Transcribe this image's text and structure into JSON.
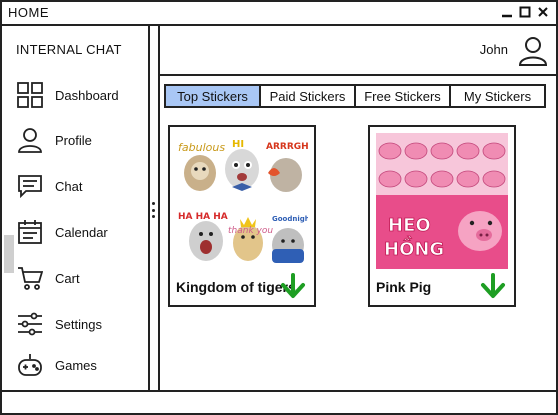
{
  "window": {
    "title": "HOME",
    "controls": [
      "minimize-icon",
      "maximize-icon",
      "close-icon"
    ]
  },
  "sidebar": {
    "app_title": "INTERNAL CHAT",
    "items": [
      {
        "label": "Dashboard",
        "icon": "dashboard-grid-icon"
      },
      {
        "label": "Profile",
        "icon": "user-icon"
      },
      {
        "label": "Chat",
        "icon": "chat-icon"
      },
      {
        "label": "Calendar",
        "icon": "calendar-icon"
      },
      {
        "label": "Cart",
        "icon": "cart-icon"
      },
      {
        "label": "Settings",
        "icon": "sliders-icon"
      },
      {
        "label": "Games",
        "icon": "gamepad-icon"
      }
    ],
    "active_index": 4
  },
  "header": {
    "user_name": "John",
    "avatar_icon": "user-icon"
  },
  "tabs": [
    {
      "label": "Top Stickers",
      "active": true
    },
    {
      "label": "Paid Stickers",
      "active": false
    },
    {
      "label": "Free Stickers",
      "active": false
    },
    {
      "label": "My Stickers",
      "active": false
    }
  ],
  "sticker_packs": [
    {
      "name": "Kingdom of tigers",
      "action_icon": "download-arrow-icon",
      "sticker_texts": [
        "fabulous",
        "HI",
        "ARRRGH",
        "HA HA HA",
        "thank you",
        "Goodnight"
      ]
    },
    {
      "name": "Pink Pig",
      "action_icon": "download-arrow-icon",
      "sticker_texts": [
        "HEO",
        "HỒNG"
      ]
    }
  ],
  "colors": {
    "active_tab": "#a9c7f5",
    "download_arrow": "#1e9e23",
    "pig_background": "#e84d8a",
    "border": "#222222"
  }
}
